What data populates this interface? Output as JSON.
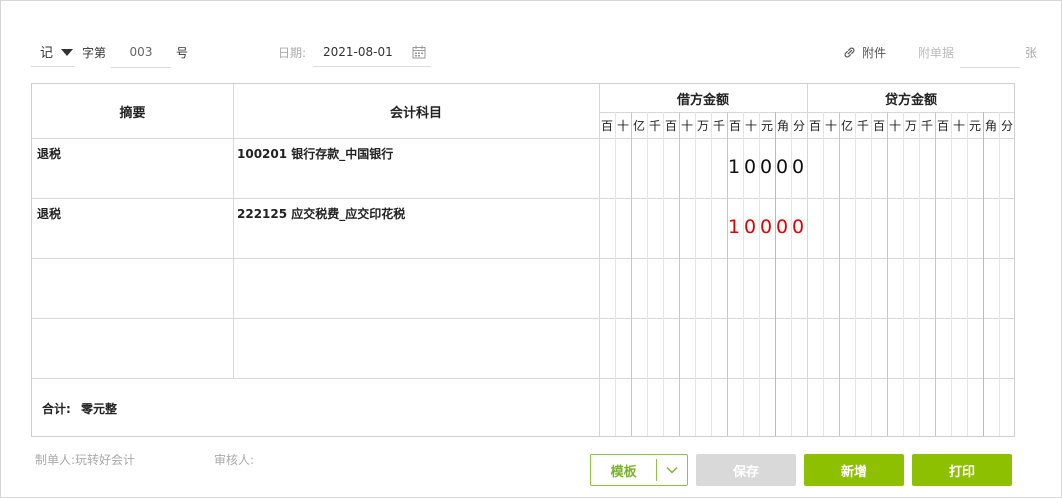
{
  "header": {
    "voucher_type": "记",
    "label_zi": "字第",
    "voucher_number": "003",
    "label_hao": "号",
    "date_label": "日期:",
    "date_value": "2021-08-01",
    "attachment_label": "附件",
    "document_count_label": "附单据",
    "document_count_value": "",
    "unit_zhang": "张"
  },
  "table": {
    "col_summary": "摘要",
    "col_account": "会计科目",
    "col_debit": "借方金额",
    "col_credit": "贷方金额",
    "digit_units": [
      "百",
      "十",
      "亿",
      "千",
      "百",
      "十",
      "万",
      "千",
      "百",
      "十",
      "元",
      "角",
      "分"
    ],
    "rows": [
      {
        "summary": "退税",
        "account": "100201 银行存款_中国银行",
        "debit": "10000",
        "credit": ""
      },
      {
        "summary": "退税",
        "account": "222125 应交税费_应交印花税",
        "debit": "10000",
        "credit": ""
      },
      {
        "summary": "",
        "account": "",
        "debit": "",
        "credit": ""
      },
      {
        "summary": "",
        "account": "",
        "debit": "",
        "credit": ""
      }
    ],
    "total_label": "合计:",
    "total_value": "零元整"
  },
  "footer": {
    "maker_label": "制单人:",
    "maker_name": "玩转好会计",
    "reviewer_label": "审核人:",
    "reviewer_name": ""
  },
  "buttons": {
    "template": "模板",
    "save": "保存",
    "new": "新增",
    "print": "打印"
  },
  "colors": {
    "accent_green": "#8dc000",
    "negative_red": "#e60000",
    "disabled_gray": "#d9d9d9",
    "yuan_separator": "#e8a6a6",
    "group_separator": "#a9d2ea"
  }
}
